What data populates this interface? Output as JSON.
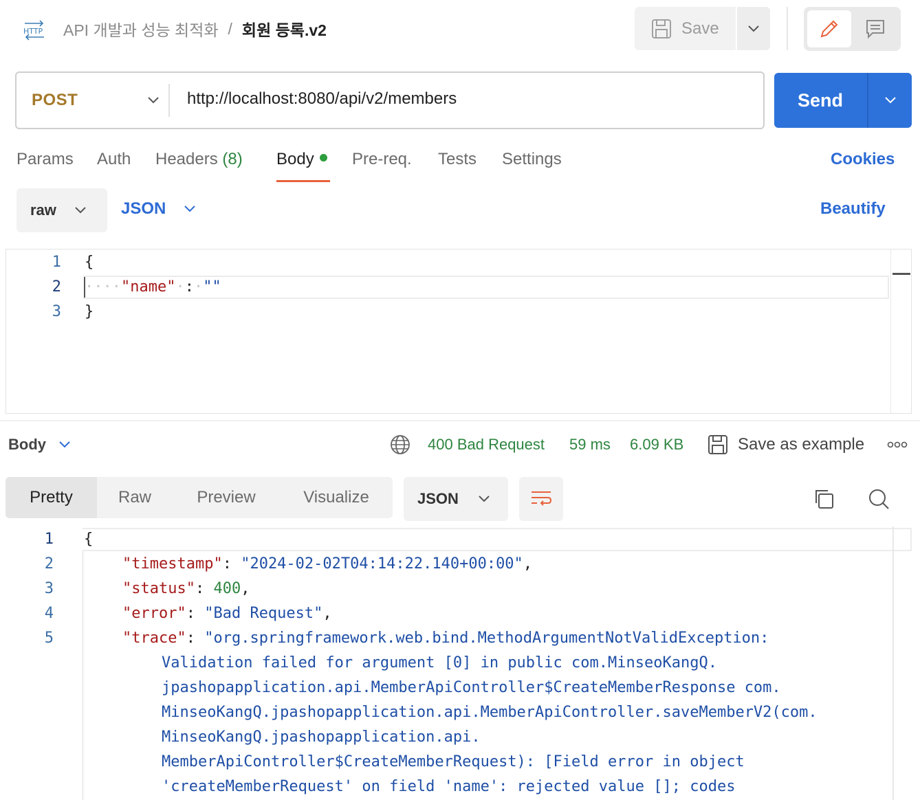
{
  "header": {
    "protocol_icon": "http-icon",
    "collection": "API 개발과 성능 최적화",
    "separator": "/",
    "request_name": "회원 등록.v2",
    "save_label": "Save"
  },
  "request": {
    "method": "POST",
    "url": "http://localhost:8080/api/v2/members",
    "send_label": "Send"
  },
  "tabs": {
    "params": "Params",
    "auth": "Auth",
    "headers": "Headers",
    "headers_count": "(8)",
    "body": "Body",
    "prereq": "Pre-req.",
    "tests": "Tests",
    "settings": "Settings",
    "cookies": "Cookies"
  },
  "body_mode": {
    "type": "raw",
    "language": "JSON",
    "beautify": "Beautify"
  },
  "request_body": {
    "line_numbers": [
      "1",
      "2",
      "3"
    ],
    "lines": [
      "{",
      "\"name\" : \"\"",
      "}"
    ],
    "key": "\"name\"",
    "colon": ":",
    "value": "\"\"",
    "open": "{",
    "close": "}"
  },
  "response": {
    "section_label": "Body",
    "status": "400 Bad Request",
    "time": "59 ms",
    "size": "6.09 KB",
    "save_example": "Save as example",
    "view_tabs": [
      "Pretty",
      "Raw",
      "Preview",
      "Visualize"
    ],
    "format": "JSON",
    "line_numbers": [
      "1",
      "2",
      "3",
      "4",
      "5"
    ],
    "open": "{",
    "timestamp_key": "\"timestamp\"",
    "timestamp_value": "\"2024-02-02T04:14:22.140+00:00\"",
    "status_key": "\"status\"",
    "status_value": "400",
    "error_key": "\"error\"",
    "error_value": "\"Bad Request\"",
    "trace_key": "\"trace\"",
    "trace_lines": [
      "\"org.springframework.web.bind.MethodArgumentNotValidException:",
      "Validation failed for argument [0] in public com.MinseoKangQ.",
      "jpashopapplication.api.MemberApiController$CreateMemberResponse com.",
      "MinseoKangQ.jpashopapplication.api.MemberApiController.saveMemberV2(com.",
      "MinseoKangQ.jpashopapplication.api.",
      "MemberApiController$CreateMemberRequest): [Field error in object",
      "'createMemberRequest' on field 'name': rejected value []; codes"
    ]
  },
  "colors": {
    "accent": "#2d72da",
    "method": "#a5792a",
    "status_ok_text": "#2e8540",
    "active_tab_underline": "#e8613b"
  }
}
